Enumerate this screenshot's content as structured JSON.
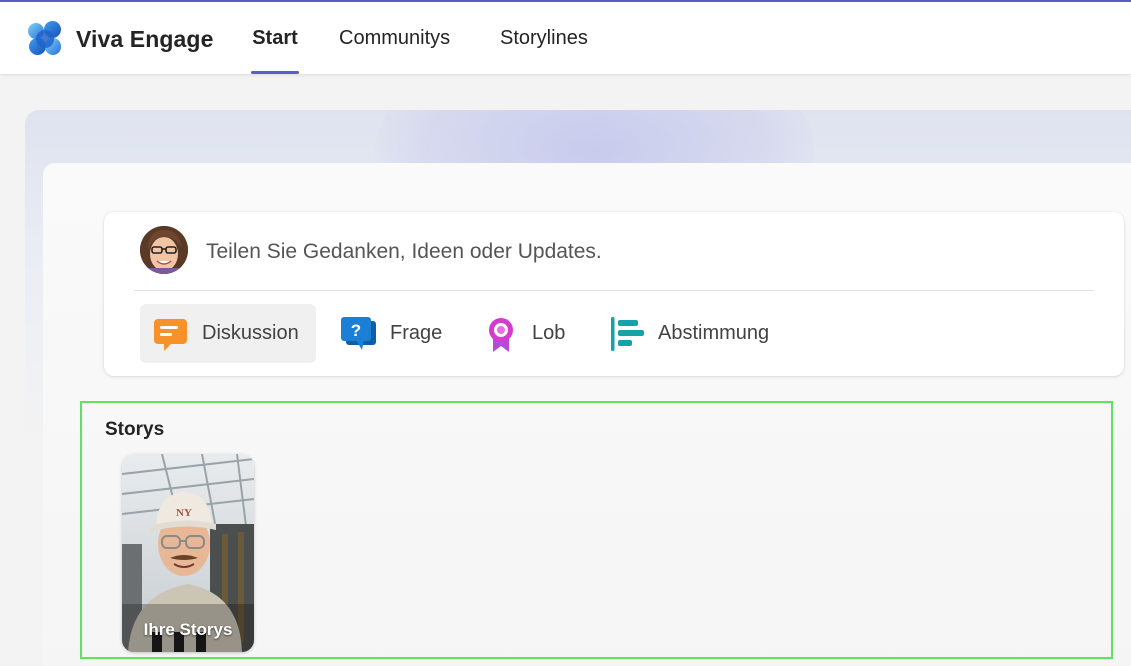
{
  "app": {
    "name": "Viva Engage",
    "accent_color": "#5b5fc7"
  },
  "nav": {
    "tabs": [
      {
        "label": "Start",
        "active": true
      },
      {
        "label": "Communitys",
        "active": false
      },
      {
        "label": "Storylines",
        "active": false
      }
    ]
  },
  "composer": {
    "placeholder": "Teilen Sie Gedanken, Ideen oder Updates.",
    "post_types": [
      {
        "label": "Diskussion",
        "icon": "discussion-icon",
        "color": "#f7922b",
        "selected": true
      },
      {
        "label": "Frage",
        "icon": "question-icon",
        "color": "#1b7fd6",
        "selected": false
      },
      {
        "label": "Lob",
        "icon": "praise-badge-icon",
        "color": "#d43ccf",
        "selected": false
      },
      {
        "label": "Abstimmung",
        "icon": "poll-icon",
        "color": "#13a3a8",
        "selected": false
      }
    ]
  },
  "stories": {
    "title": "Storys",
    "items": [
      {
        "label": "Ihre Storys"
      }
    ]
  }
}
